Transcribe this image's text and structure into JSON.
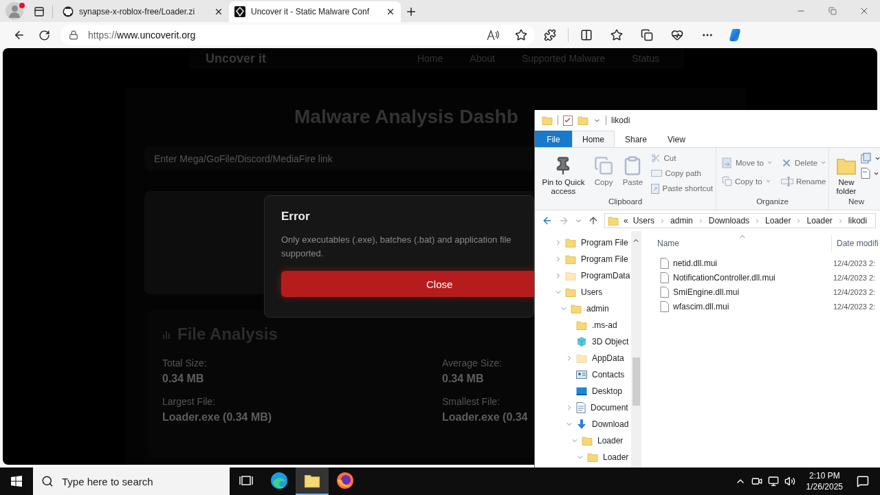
{
  "browser": {
    "tabs": [
      {
        "title": "synapse-x-roblox-free/Loader.zi",
        "selected": false
      },
      {
        "title": "Uncover it - Static Malware Conf",
        "selected": true
      }
    ],
    "url_scheme": "https://",
    "url_host": "www.uncoverit.org"
  },
  "page": {
    "brand": "Uncover it",
    "nav": [
      "Home",
      "About",
      "Supported Malware",
      "Status"
    ],
    "title": "Malware Analysis Dashb",
    "link_placeholder": "Enter Mega/GoFile/Discord/MediaFire link",
    "analysis": {
      "title": "File Analysis",
      "stats": [
        {
          "label": "Total Size:",
          "value": "0.34 MB"
        },
        {
          "label": "Average Size:",
          "value": "0.34 MB"
        },
        {
          "label": "Largest File:",
          "value": "Loader.exe (0.34 MB)"
        },
        {
          "label": "Smallest File:",
          "value": "Loader.exe (0.34"
        }
      ]
    }
  },
  "dialog": {
    "title": "Error",
    "message_lines": [
      "Only executables (.exe), batches (.bat) and application file",
      "supported."
    ],
    "button": "Close"
  },
  "explorer": {
    "title": "likodi",
    "ribbon_tabs": [
      {
        "label": "File",
        "kind": "menu",
        "selected": false
      },
      {
        "label": "Home",
        "kind": "tab",
        "selected": true
      },
      {
        "label": "Share",
        "kind": "tab",
        "selected": false
      },
      {
        "label": "View",
        "kind": "tab",
        "selected": false
      }
    ],
    "ribbon_groups": [
      {
        "label": "Clipboard",
        "commands": [
          {
            "label": "Pin to Quick access",
            "kind": "large",
            "disabled": false,
            "dropdown": false
          },
          {
            "label": "Copy",
            "kind": "large",
            "disabled": true,
            "dropdown": false
          },
          {
            "label": "Paste",
            "kind": "large",
            "disabled": true,
            "dropdown": false
          },
          {
            "label": "Cut",
            "kind": "small",
            "disabled": true,
            "dropdown": false
          },
          {
            "label": "Copy path",
            "kind": "small",
            "disabled": true,
            "dropdown": false
          },
          {
            "label": "Paste shortcut",
            "kind": "small",
            "disabled": true,
            "dropdown": false
          }
        ]
      },
      {
        "label": "Organize",
        "commands": [
          {
            "label": "Move to",
            "kind": "small",
            "disabled": true,
            "dropdown": true
          },
          {
            "label": "Copy to",
            "kind": "small",
            "disabled": true,
            "dropdown": true
          },
          {
            "label": "Delete",
            "kind": "small",
            "disabled": true,
            "dropdown": true
          },
          {
            "label": "Rename",
            "kind": "small",
            "disabled": true,
            "dropdown": false
          }
        ]
      },
      {
        "label": "New",
        "commands": [
          {
            "label": "New folder",
            "kind": "large",
            "disabled": false,
            "dropdown": false
          },
          {
            "kind": "icon",
            "disabled": false,
            "dropdown": true
          },
          {
            "kind": "icon",
            "disabled": false,
            "dropdown": true
          }
        ]
      }
    ],
    "nav_buttons": [
      {
        "kind": "back",
        "disabled": false
      },
      {
        "kind": "forward",
        "disabled": true
      },
      {
        "kind": "recent",
        "disabled": false
      },
      {
        "kind": "up",
        "disabled": false
      }
    ],
    "overflow_mark": "«",
    "path": [
      "Users",
      "admin",
      "Downloads",
      "Loader",
      "Loader",
      "likodi"
    ],
    "tree": [
      {
        "label": "Program File",
        "kind": "folder",
        "expandable": true,
        "expanded": false
      },
      {
        "label": "Program File",
        "kind": "folder",
        "expandable": true,
        "expanded": false
      },
      {
        "label": "ProgramData",
        "kind": "hidden-folder",
        "expandable": true,
        "expanded": false
      },
      {
        "label": "Users",
        "kind": "folder",
        "expandable": true,
        "expanded": true,
        "children": [
          {
            "label": "admin",
            "kind": "folder",
            "expandable": true,
            "expanded": true,
            "children": [
              {
                "label": ".ms-ad",
                "kind": "folder",
                "expandable": false
              },
              {
                "label": "3D Object",
                "kind": "objects",
                "expandable": false
              },
              {
                "label": "AppData",
                "kind": "hidden-folder",
                "expandable": true,
                "expanded": false
              },
              {
                "label": "Contacts",
                "kind": "contacts",
                "expandable": false
              },
              {
                "label": "Desktop",
                "kind": "desktop",
                "expandable": false
              },
              {
                "label": "Document",
                "kind": "documents",
                "expandable": true,
                "expanded": false
              },
              {
                "label": "Download",
                "kind": "downloads",
                "expandable": true,
                "expanded": true,
                "children": [
                  {
                    "label": "Loader",
                    "kind": "folder",
                    "expandable": true,
                    "expanded": true,
                    "children": [
                      {
                        "label": "Loader",
                        "kind": "folder",
                        "expandable": true,
                        "expanded": true
                      }
                    ]
                  }
                ]
              }
            ]
          }
        ]
      }
    ],
    "columns": [
      "Name",
      "Date modifi"
    ],
    "files": [
      {
        "name": "netid.dll.mui",
        "date": "12/4/2023 2:"
      },
      {
        "name": "NotificationController.dll.mui",
        "date": "12/4/2023 2:"
      },
      {
        "name": "SmiEngine.dll.mui",
        "date": "12/4/2023 2:"
      },
      {
        "name": "wfascim.dll.mui",
        "date": "12/4/2023 2:"
      }
    ]
  },
  "taskbar": {
    "search_placeholder": "Type here to search",
    "apps": [
      {
        "kind": "task-view",
        "active": false
      },
      {
        "kind": "browser",
        "active": false
      },
      {
        "kind": "files",
        "active": true
      },
      {
        "kind": "fox",
        "active": false
      }
    ],
    "time": "2:10 PM",
    "date": "1/26/2025"
  }
}
